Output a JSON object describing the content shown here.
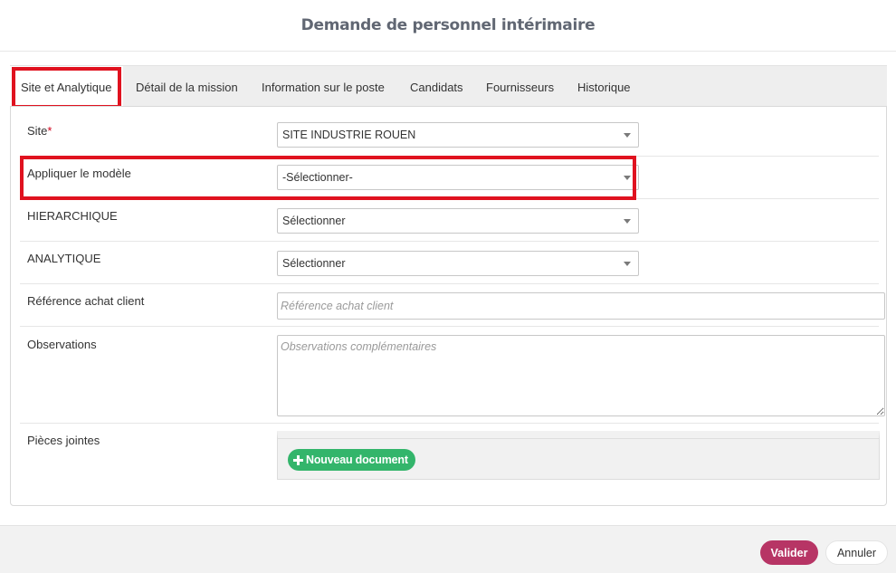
{
  "modal": {
    "title": "Demande de personnel intérimaire"
  },
  "tabs": [
    {
      "label": "Site et Analytique",
      "active": true
    },
    {
      "label": "Détail de la mission",
      "active": false
    },
    {
      "label": "Information sur le poste",
      "active": false
    },
    {
      "label": "Candidats",
      "active": false
    },
    {
      "label": "Fournisseurs",
      "active": false
    },
    {
      "label": "Historique",
      "active": false
    }
  ],
  "form": {
    "site": {
      "label": "Site",
      "required_mark": "*",
      "value": "SITE INDUSTRIE ROUEN"
    },
    "template": {
      "label": "Appliquer le modèle",
      "value": "-Sélectionner-"
    },
    "hierarchy": {
      "label": "HIERARCHIQUE",
      "value": "Sélectionner"
    },
    "analytics": {
      "label": "ANALYTIQUE",
      "value": "Sélectionner"
    },
    "purchase_ref": {
      "label": "Référence achat client",
      "placeholder": "Référence achat client",
      "value": ""
    },
    "observations": {
      "label": "Observations",
      "placeholder": "Observations complémentaires",
      "value": ""
    },
    "attachments": {
      "label": "Pièces jointes",
      "new_document_label": "Nouveau document"
    }
  },
  "footer": {
    "validate_label": "Valider",
    "cancel_label": "Annuler"
  },
  "colors": {
    "highlight": "#e0121f",
    "validate": "#b73565",
    "new_document": "#33b56b"
  },
  "icons": {
    "caret": "caret-down-icon",
    "plus": "plus-icon"
  }
}
